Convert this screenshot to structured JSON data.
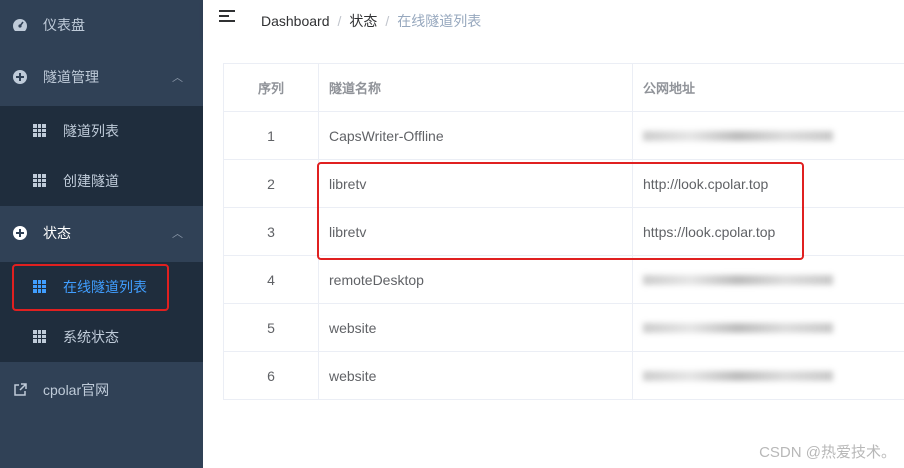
{
  "sidebar": {
    "dashboard": "仪表盘",
    "tunnel_mgmt": "隧道管理",
    "tunnel_list": "隧道列表",
    "create_tunnel": "创建隧道",
    "status": "状态",
    "online_tunnels": "在线隧道列表",
    "system_status": "系统状态",
    "cpolar_site": "cpolar官网"
  },
  "header": {
    "breadcrumb": [
      "Dashboard",
      "状态",
      "在线隧道列表"
    ],
    "sep": "/"
  },
  "table": {
    "columns": [
      "序列",
      "隧道名称",
      "公网地址"
    ],
    "rows": [
      {
        "idx": "1",
        "name": "CapsWriter-Offline",
        "url": "",
        "blurred": true
      },
      {
        "idx": "2",
        "name": "libretv",
        "url": "http://look.cpolar.top",
        "blurred": false
      },
      {
        "idx": "3",
        "name": "libretv",
        "url": "https://look.cpolar.top",
        "blurred": false
      },
      {
        "idx": "4",
        "name": "remoteDesktop",
        "url": "",
        "blurred": true
      },
      {
        "idx": "5",
        "name": "website",
        "url": "",
        "blurred": true
      },
      {
        "idx": "6",
        "name": "website",
        "url": "",
        "blurred": true
      }
    ]
  },
  "watermark": "CSDN @热爱技术。",
  "colors": {
    "sidebar_bg": "#304156",
    "submenu_bg": "#1f2d3d",
    "active": "#409eff",
    "highlight": "#e02020"
  }
}
